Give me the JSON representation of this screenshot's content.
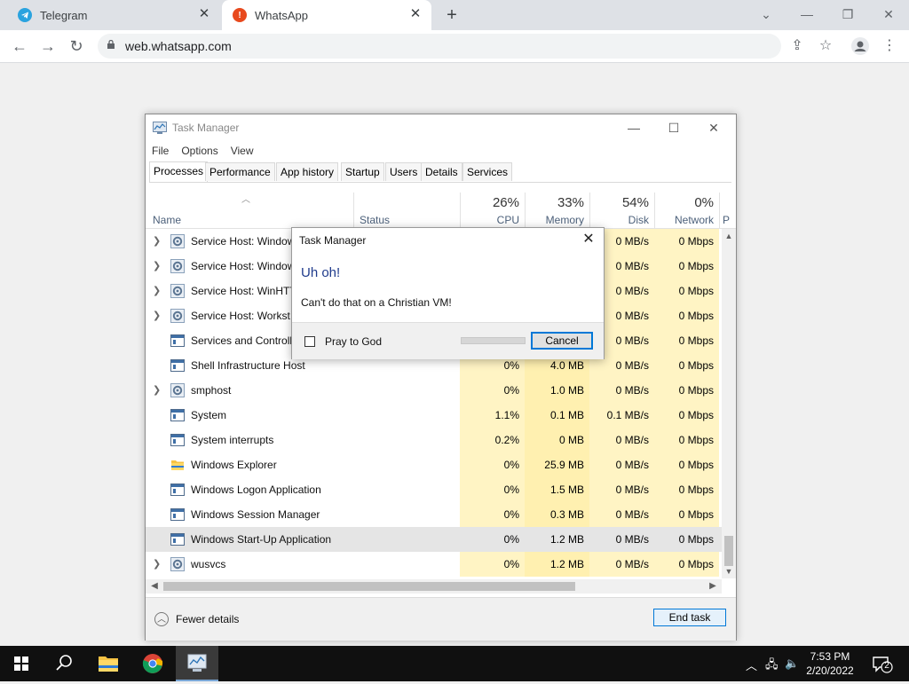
{
  "browser": {
    "tabs": [
      {
        "label": "Telegram",
        "icon": "telegram-icon",
        "color": "#2aa3df"
      },
      {
        "label": "WhatsApp",
        "icon": "alert-icon",
        "color": "#e8491d"
      }
    ],
    "url": "web.whatsapp.com"
  },
  "task_manager": {
    "title": "Task Manager",
    "menu": [
      "File",
      "Options",
      "View"
    ],
    "tabs": [
      "Processes",
      "Performance",
      "App history",
      "Startup",
      "Users",
      "Details",
      "Services"
    ],
    "active_tab": "Processes",
    "columns": {
      "name": "Name",
      "status": "Status",
      "cpu_pct": "26%",
      "cpu": "CPU",
      "mem_pct": "33%",
      "mem": "Memory",
      "disk_pct": "54%",
      "disk": "Disk",
      "net_pct": "0%",
      "net": "Network",
      "power": "P"
    },
    "rows": [
      {
        "name": "Service Host: Windows",
        "cpu": "",
        "mem": "",
        "disk": "0 MB/s",
        "net": "0 Mbps",
        "expand": true,
        "icon": "gear"
      },
      {
        "name": "Service Host: Windows",
        "cpu": "",
        "mem": "",
        "disk": "0 MB/s",
        "net": "0 Mbps",
        "expand": true,
        "icon": "gear"
      },
      {
        "name": "Service Host: WinHTT",
        "cpu": "",
        "mem": "",
        "disk": "0 MB/s",
        "net": "0 Mbps",
        "expand": true,
        "icon": "gear"
      },
      {
        "name": "Service Host: Workst",
        "cpu": "",
        "mem": "",
        "disk": "0 MB/s",
        "net": "0 Mbps",
        "expand": true,
        "icon": "gear"
      },
      {
        "name": "Services and Controlle",
        "cpu": "",
        "mem": "",
        "disk": "0 MB/s",
        "net": "0 Mbps",
        "expand": false,
        "icon": "window"
      },
      {
        "name": "Shell Infrastructure Host",
        "cpu": "0%",
        "mem": "4.0 MB",
        "disk": "0 MB/s",
        "net": "0 Mbps",
        "expand": false,
        "icon": "window"
      },
      {
        "name": "smphost",
        "cpu": "0%",
        "mem": "1.0 MB",
        "disk": "0 MB/s",
        "net": "0 Mbps",
        "expand": true,
        "icon": "gear"
      },
      {
        "name": "System",
        "cpu": "1.1%",
        "mem": "0.1 MB",
        "disk": "0.1 MB/s",
        "net": "0 Mbps",
        "expand": false,
        "icon": "window"
      },
      {
        "name": "System interrupts",
        "cpu": "0.2%",
        "mem": "0 MB",
        "disk": "0 MB/s",
        "net": "0 Mbps",
        "expand": false,
        "icon": "window"
      },
      {
        "name": "Windows Explorer",
        "cpu": "0%",
        "mem": "25.9 MB",
        "disk": "0 MB/s",
        "net": "0 Mbps",
        "expand": false,
        "icon": "folder"
      },
      {
        "name": "Windows Logon Application",
        "cpu": "0%",
        "mem": "1.5 MB",
        "disk": "0 MB/s",
        "net": "0 Mbps",
        "expand": false,
        "icon": "window"
      },
      {
        "name": "Windows Session Manager",
        "cpu": "0%",
        "mem": "0.3 MB",
        "disk": "0 MB/s",
        "net": "0 Mbps",
        "expand": false,
        "icon": "window"
      },
      {
        "name": "Windows Start-Up Application",
        "cpu": "0%",
        "mem": "1.2 MB",
        "disk": "0 MB/s",
        "net": "0 Mbps",
        "expand": false,
        "icon": "window",
        "selected": true
      },
      {
        "name": "wusvcs",
        "cpu": "0%",
        "mem": "1.2 MB",
        "disk": "0 MB/s",
        "net": "0 Mbps",
        "expand": true,
        "icon": "gear"
      }
    ],
    "fewer_details": "Fewer details",
    "end_task": "End task"
  },
  "dialog": {
    "title": "Task Manager",
    "heading": "Uh oh!",
    "message": "Can't do that on a Christian VM!",
    "checkbox_label": "Pray to God",
    "progress": 0,
    "cancel": "Cancel"
  },
  "taskbar": {
    "time": "7:53 PM",
    "date": "2/20/2022",
    "notifications": "2"
  }
}
